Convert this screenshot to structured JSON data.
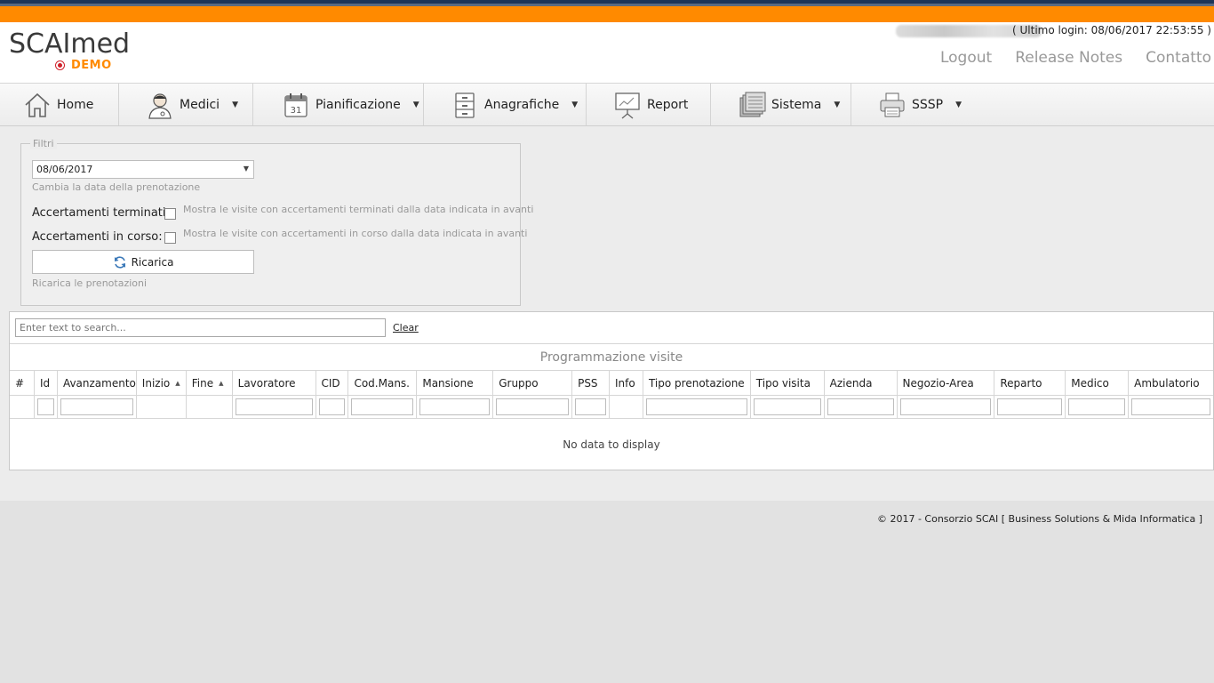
{
  "app": {
    "logo_text": "SCAImed",
    "logo_badge": "DEMO"
  },
  "header": {
    "last_login": "( Ultimo login: 08/06/2017 22:53:55 )",
    "links": [
      "Logout",
      "Release Notes",
      "Contatto"
    ]
  },
  "menu": [
    {
      "label": "Home",
      "icon": "home-icon",
      "has_dropdown": false
    },
    {
      "label": "Medici",
      "icon": "doctor-icon",
      "has_dropdown": true
    },
    {
      "label": "Pianificazione",
      "icon": "calendar-icon",
      "has_dropdown": true,
      "icon_text": "31"
    },
    {
      "label": "Anagrafiche",
      "icon": "cabinet-icon",
      "has_dropdown": true
    },
    {
      "label": "Report",
      "icon": "presentation-icon",
      "has_dropdown": false
    },
    {
      "label": "Sistema",
      "icon": "servers-icon",
      "has_dropdown": true
    },
    {
      "label": "SSSP",
      "icon": "printer-icon",
      "has_dropdown": true
    }
  ],
  "filters": {
    "legend": "Filtri",
    "date_value": "08/06/2017",
    "date_hint": "Cambia la data della prenotazione",
    "completed_label": "Accertamenti terminati:",
    "completed_hint": "Mostra le visite con accertamenti terminati dalla data indicata in avanti",
    "inprogress_label": "Accertamenti in corso:",
    "inprogress_hint": "Mostra le visite con accertamenti in corso dalla data indicata in avanti",
    "reload_label": "Ricarica",
    "reload_hint": "Ricarica le prenotazioni"
  },
  "grid": {
    "search_placeholder": "Enter text to search...",
    "clear_label": "Clear",
    "title": "Programmazione visite",
    "columns": [
      {
        "label": "#",
        "sortable": false,
        "filter": false
      },
      {
        "label": "Id",
        "sortable": false,
        "filter": true
      },
      {
        "label": "Avanzamento",
        "sortable": false,
        "filter": true
      },
      {
        "label": "Inizio",
        "sortable": true,
        "filter": false
      },
      {
        "label": "Fine",
        "sortable": true,
        "filter": false
      },
      {
        "label": "Lavoratore",
        "sortable": false,
        "filter": true
      },
      {
        "label": "CID",
        "sortable": false,
        "filter": true
      },
      {
        "label": "Cod.Mans.",
        "sortable": false,
        "filter": true
      },
      {
        "label": "Mansione",
        "sortable": false,
        "filter": true
      },
      {
        "label": "Gruppo",
        "sortable": false,
        "filter": true
      },
      {
        "label": "PSS",
        "sortable": false,
        "filter": true
      },
      {
        "label": "Info",
        "sortable": false,
        "filter": false
      },
      {
        "label": "Tipo prenotazione",
        "sortable": false,
        "filter": true
      },
      {
        "label": "Tipo visita",
        "sortable": false,
        "filter": true
      },
      {
        "label": "Azienda",
        "sortable": false,
        "filter": true
      },
      {
        "label": "Negozio-Area",
        "sortable": false,
        "filter": true
      },
      {
        "label": "Reparto",
        "sortable": false,
        "filter": true
      },
      {
        "label": "Medico",
        "sortable": false,
        "filter": true
      },
      {
        "label": "Ambulatorio",
        "sortable": false,
        "filter": true
      }
    ],
    "empty_text": "No data to display"
  },
  "footer": {
    "copyright": "© 2017 - Consorzio SCAI [ Business Solutions & Mida Informatica ]"
  },
  "colors": {
    "accent": "#ff8a00",
    "navy": "#1d3557",
    "logo_dot": "#d0202a"
  }
}
